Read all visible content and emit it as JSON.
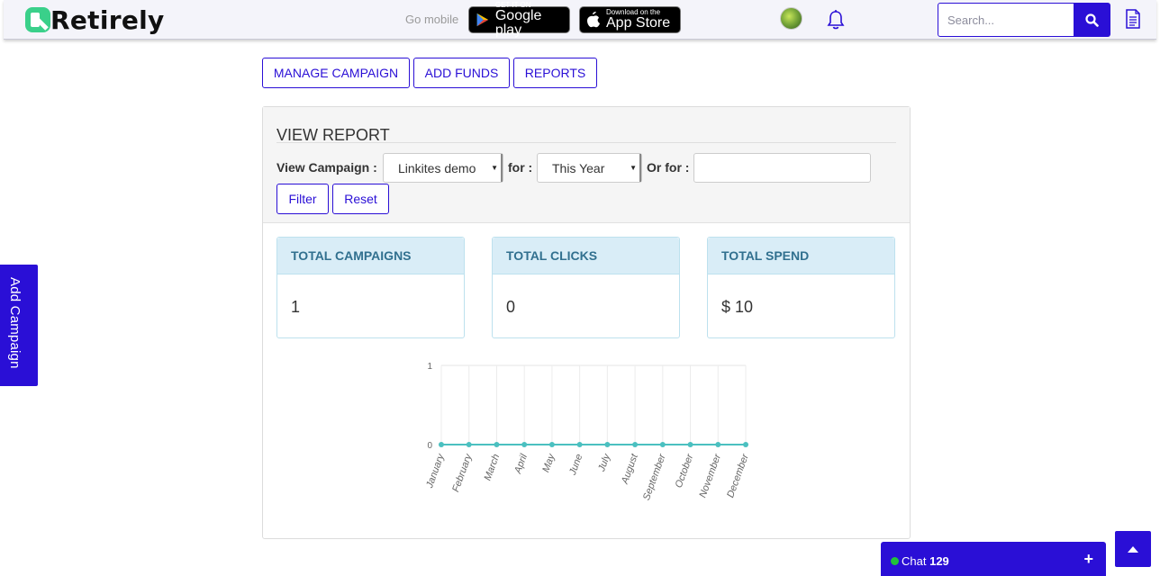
{
  "header": {
    "brand": "Retirely",
    "go_mobile": "Go mobile",
    "google_small": "GET IT ON",
    "google_big": "Google play",
    "apple_small": "Download on the",
    "apple_big": "App Store",
    "search_placeholder": "Search..."
  },
  "nav": {
    "manage_campaign": "MANAGE CAMPAIGN",
    "add_funds": "ADD FUNDS",
    "reports": "REPORTS"
  },
  "report": {
    "title": "VIEW REPORT",
    "view_campaign_label": "View Campaign :",
    "campaign_selected": "Linkites demo",
    "for_label": "for :",
    "period_selected": "This Year",
    "or_for_label": "Or for :",
    "or_for_value": "",
    "filter_label": "Filter",
    "reset_label": "Reset"
  },
  "stats": [
    {
      "label": "TOTAL CAMPAIGNS",
      "value": "1"
    },
    {
      "label": "TOTAL CLICKS",
      "value": "0"
    },
    {
      "label": "TOTAL SPEND",
      "value": "$ 10"
    }
  ],
  "chart_data": {
    "type": "line",
    "categories": [
      "January",
      "February",
      "March",
      "April",
      "May",
      "June",
      "July",
      "August",
      "September",
      "October",
      "November",
      "December"
    ],
    "series": [
      {
        "values": [
          0,
          0,
          0,
          0,
          0,
          0,
          0,
          0,
          0,
          0,
          0,
          0
        ]
      }
    ],
    "yticks": [
      "0",
      "1"
    ],
    "ylim": [
      0,
      1
    ],
    "grid": true,
    "color": "#4bc0c0"
  },
  "side_tab": {
    "label": "Add Campaign"
  },
  "chat": {
    "label": "Chat",
    "count": "129",
    "expand": "+"
  },
  "colors": {
    "accent": "#2a0fd6",
    "info_bg": "#d9edf7",
    "info_text": "#31708f",
    "online": "#21c23a"
  }
}
